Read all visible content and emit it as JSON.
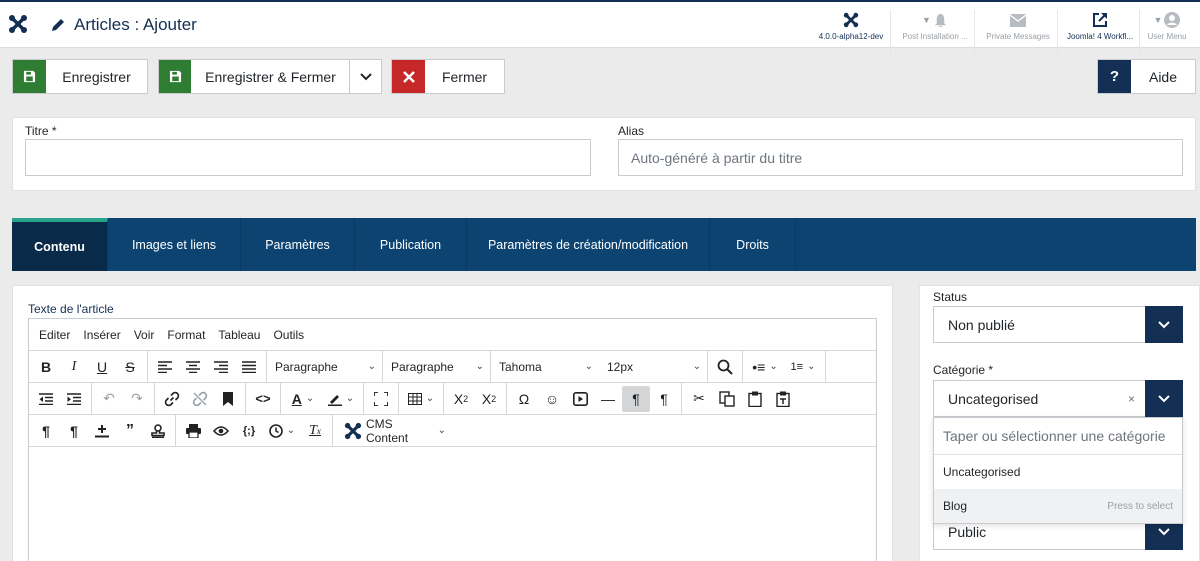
{
  "header": {
    "title": "Articles : Ajouter",
    "items": [
      {
        "label": "4.0.0-alpha12-dev",
        "icon": "joomla-icon"
      },
      {
        "label": "Post Installation ...",
        "icon": "bell-icon"
      },
      {
        "label": "Private Messages",
        "icon": "envelope-icon"
      },
      {
        "label": "Joomla! 4 Workfl...",
        "icon": "external-link-icon"
      },
      {
        "label": "User Menu",
        "icon": "user-icon"
      }
    ]
  },
  "toolbar": {
    "save_label": "Enregistrer",
    "save_close_label": "Enregistrer & Fermer",
    "close_label": "Fermer",
    "help_label": "Aide",
    "help_icon_text": "?"
  },
  "form": {
    "title_label": "Titre *",
    "title_value": "",
    "alias_label": "Alias",
    "alias_placeholder": "Auto-généré à partir du titre"
  },
  "tabs": [
    {
      "label": "Contenu",
      "active": true
    },
    {
      "label": "Images et liens"
    },
    {
      "label": "Paramètres"
    },
    {
      "label": "Publication"
    },
    {
      "label": "Paramètres de création/modification"
    },
    {
      "label": "Droits"
    }
  ],
  "editor": {
    "label": "Texte de l'article",
    "menu": [
      "Editer",
      "Insérer",
      "Voir",
      "Format",
      "Tableau",
      "Outils"
    ],
    "block_format": "Paragraphe",
    "style_format": "Paragraphe",
    "font_family": "Tahoma",
    "font_size": "12px",
    "cms_content": "CMS Content",
    "content": ""
  },
  "sidebar": {
    "status_label": "Status",
    "status_value": "Non publié",
    "category_label": "Catégorie *",
    "category_value": "Uncategorised",
    "category_search_placeholder": "Taper ou sélectionner une catégorie",
    "category_options": [
      "Uncategorised",
      "Blog"
    ],
    "press_hint": "Press to select",
    "access_value": "Public"
  },
  "colors": {
    "navy": "#132f53",
    "tabs_bg": "#0c4371",
    "tab_accent": "#27a38a",
    "save_green": "#2f7d32",
    "close_red": "#c52827"
  }
}
